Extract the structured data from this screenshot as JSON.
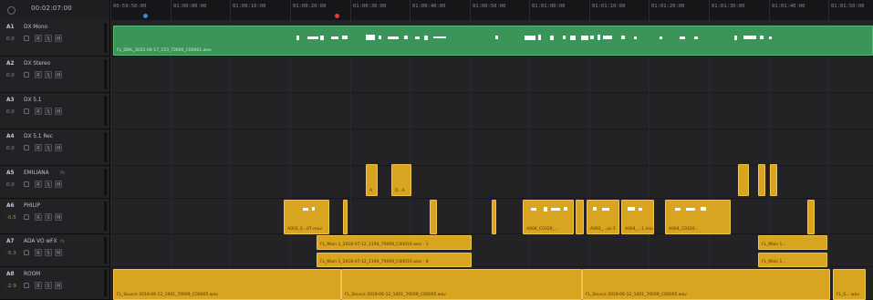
{
  "timecode": "00:02:07:00",
  "ruler_labels": [
    "00:59:50:00",
    "01:00:00:00",
    "01:00:10:00",
    "01:00:20:00",
    "01:00:30:00",
    "01:00:40:00",
    "01:00:50:00",
    "01:01:00:00",
    "01:01:10:00",
    "01:01:20:00",
    "01:01:30:00",
    "01:01:40:00",
    "01:01:50:00"
  ],
  "tracks": [
    {
      "id": "A1",
      "name": "DX Mono",
      "vol": "0.0",
      "fx": "",
      "buttons": [
        "R",
        "S",
        "M"
      ]
    },
    {
      "id": "A2",
      "name": "DX Stereo",
      "vol": "0.0",
      "fx": "",
      "buttons": [
        "R",
        "S",
        "M"
      ]
    },
    {
      "id": "A3",
      "name": "DX 5.1",
      "vol": "0.0",
      "fx": "",
      "buttons": [
        "R",
        "S",
        "M"
      ]
    },
    {
      "id": "A4",
      "name": "DX 5.1 Rec",
      "vol": "0.0",
      "fx": "",
      "buttons": [
        "R",
        "S",
        "M"
      ]
    },
    {
      "id": "A5",
      "name": "EMILIANA",
      "vol": "0.0",
      "fx": "fx",
      "buttons": [
        "R",
        "S",
        "M"
      ]
    },
    {
      "id": "A6",
      "name": "PHILIP",
      "vol": "-0.5",
      "fx": "",
      "buttons": [
        "R",
        "S",
        "M"
      ]
    },
    {
      "id": "A7",
      "name": "ADA VO wFX",
      "vol": "-5.3",
      "fx": "fx",
      "buttons": [
        "R",
        "S",
        "M"
      ]
    },
    {
      "id": "A8",
      "name": "ROOM",
      "vol": "-2.9",
      "fx": "",
      "buttons": [
        "R",
        "S",
        "M"
      ]
    }
  ],
  "clips": {
    "a1_main": "FL_DIAL_2021-04-17_153_72600_C00001.wav",
    "a5_1": "A",
    "a5_2": "D...A",
    "a6_1": "A003_0...07.mov",
    "a6_2": "A004_C0320_...",
    "a6_3": "A003_...ov 1",
    "a6_4": "A004_...1.mov",
    "a6_5": "A004_C0320...",
    "a7_1": "FL_Main 1_2018-07-12_1194_70009_C00016.wav - 1",
    "a7_2": "FL_Main 1_2018-07-12_1194_70009_C00016.wav - 8",
    "a7_3": "FL_Main 1...",
    "a7_4": "FL_Main 1...",
    "a8_1": "FL_Source 2018-06-12_1001_70009_C00005.wav",
    "a8_2": "FL_Source 2018-06-12_1001_70009_C00005.wav",
    "a8_3": "FL_Source 2018-06-12_1001_70009_C00005.wav",
    "a8_4": "FL_S... wav"
  },
  "colors": {
    "audio_clip": "#d9a41f",
    "dialog_clip": "#3c9558",
    "playhead": "#e23b3b",
    "in_marker": "#4b7fe0"
  }
}
